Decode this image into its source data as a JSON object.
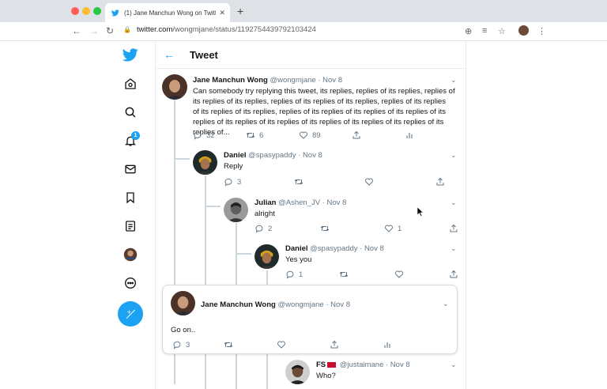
{
  "browser": {
    "tab_title": "(1) Jane Manchun Wong on Twitt",
    "url_domain": "twitter.com",
    "url_path": "/wongmjane/status/1192754439792103424"
  },
  "header": {
    "title": "Tweet"
  },
  "main_tweet": {
    "name": "Jane Manchun Wong",
    "handle": "@wongmjane · Nov 8",
    "lines": [
      "Can somebody try replying this tweet, its replies, replies of its replies, replies of",
      "its replies of its replies, replies of its replies of its replies, replies of its replies",
      "of its replies of its replies, replies of its replies of its replies of its replies of its",
      "replies of its replies of its replies of its replies of its replies of its replies of its",
      "replies of..."
    ],
    "reply_count": "32",
    "retweet_count": "6",
    "like_count": "89"
  },
  "reply1": {
    "name": "Daniel",
    "handle": "@spasypaddy · Nov 8",
    "text": "Reply",
    "reply_count": "3"
  },
  "reply2": {
    "name": "Julian",
    "handle": "@Ashen_JV · Nov 8",
    "text": "alright",
    "reply_count": "2",
    "like_count": "1"
  },
  "reply3": {
    "name": "Daniel",
    "handle": "@spasypaddy · Nov 8",
    "text": "Yes you",
    "reply_count": "1"
  },
  "composer_card": {
    "name": "Jane Manchun Wong",
    "handle": "@wongmjane · Nov 8",
    "text": "Go on..",
    "reply_count": "3"
  },
  "reply4": {
    "name": "FS",
    "handle": "@justaimane · Nov 8",
    "text": "Who?"
  },
  "colors": {
    "accent": "#1da1f2",
    "text": "#14171a",
    "muted": "#657786"
  }
}
